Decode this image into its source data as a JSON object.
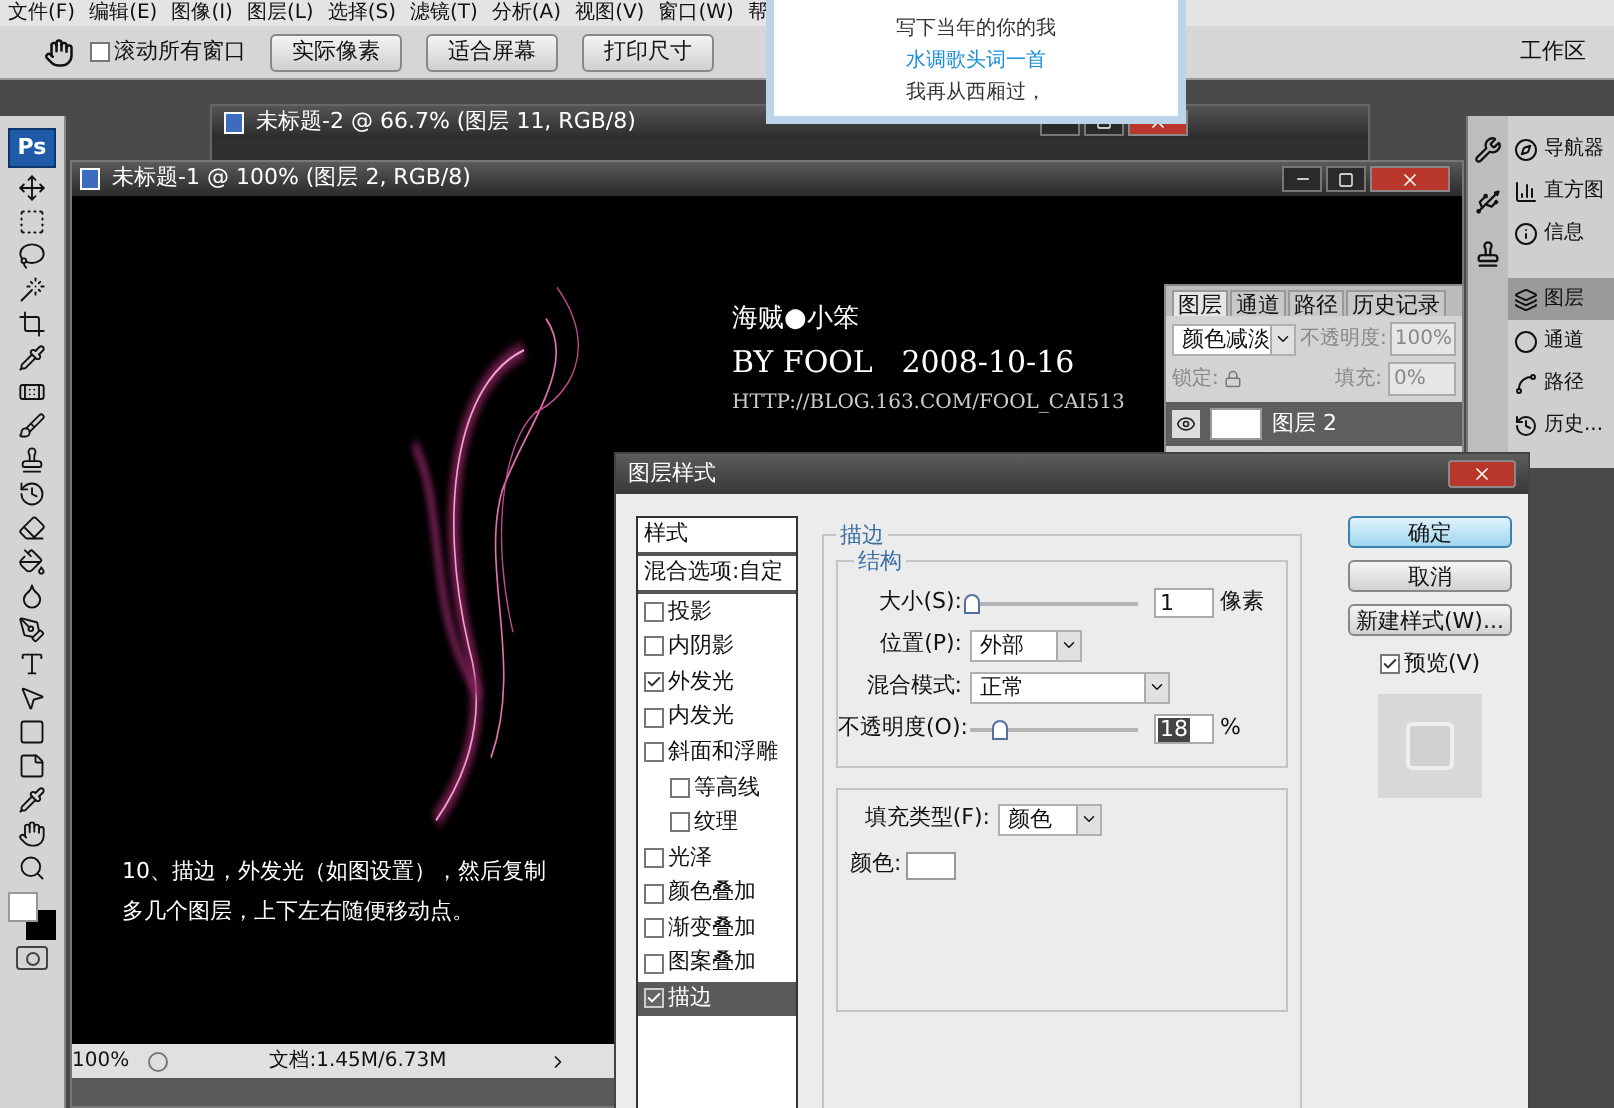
{
  "menu_bar": {
    "items": [
      "文件(F)",
      "编辑(E)",
      "图像(I)",
      "图层(L)",
      "选择(S)",
      "滤镜(T)",
      "分析(A)",
      "视图(V)",
      "窗口(W)",
      "帮"
    ]
  },
  "options_bar": {
    "scroll_all": {
      "label": "滚动所有窗口",
      "checked": false
    },
    "buttons": [
      "实际像素",
      "适合屏幕",
      "打印尺寸"
    ],
    "workspace": "工作区"
  },
  "note_popup": {
    "lines": [
      {
        "text": "写下当年的你的我",
        "kind": "plain"
      },
      {
        "text": "水调歌头词一首",
        "kind": "link"
      },
      {
        "text": "我再从西厢过，",
        "kind": "plain"
      }
    ]
  },
  "toolbox": {
    "logo": "Ps"
  },
  "back_document": {
    "title": "未标题-2 @ 66.7% (图层 11, RGB/8)"
  },
  "document": {
    "title": "未标题-1 @ 100% (图层 2, RGB/8)",
    "signature": "海贼●小笨",
    "byline": "BY FOOL   2008-10-16",
    "url": "HTTP://BLOG.163.COM/FOOL_CAI513",
    "caption_lines": [
      "10、描边，外发光（如图设置），然后复制",
      "多几个图层，上下左右随便移动点。"
    ],
    "zoom": "100%",
    "doc_size": "文档:1.45M/6.73M"
  },
  "layers_panel": {
    "tabs": [
      {
        "label": "图层",
        "selected": true
      },
      {
        "label": "通道",
        "selected": false
      },
      {
        "label": "路径",
        "selected": false
      },
      {
        "label": "历史记录",
        "selected": false
      }
    ],
    "blend_mode": "颜色减淡",
    "opacity_label": "不透明度:",
    "opacity": "100%",
    "lock_label": "锁定:",
    "fill_label": "填充:",
    "fill": "0%",
    "layers": [
      {
        "name": "图层 2",
        "visible": true,
        "selected": true
      }
    ]
  },
  "panel_dock": {
    "items": [
      {
        "label": "导航器",
        "kind": "navigator",
        "selected": false
      },
      {
        "label": "直方图",
        "kind": "histogram",
        "selected": false
      },
      {
        "label": "信息",
        "kind": "info",
        "selected": false
      },
      {
        "label": "图层",
        "kind": "layers",
        "selected": true
      },
      {
        "label": "通道",
        "kind": "channels",
        "selected": false
      },
      {
        "label": "路径",
        "kind": "paths",
        "selected": false
      },
      {
        "label": "历史...",
        "kind": "history",
        "selected": false
      }
    ]
  },
  "dialog": {
    "title": "图层样式",
    "styles": [
      {
        "label": "样式",
        "kind": "header",
        "selected": false
      },
      {
        "label": "混合选项:自定",
        "kind": "header",
        "selected": false
      },
      {
        "label": "投影",
        "kind": "check",
        "checked": false,
        "selected": false
      },
      {
        "label": "内阴影",
        "kind": "check",
        "checked": false,
        "selected": false
      },
      {
        "label": "外发光",
        "kind": "check",
        "checked": true,
        "selected": false
      },
      {
        "label": "内发光",
        "kind": "check",
        "checked": false,
        "selected": false
      },
      {
        "label": "斜面和浮雕",
        "kind": "check",
        "checked": false,
        "selected": false,
        "children": [
          {
            "label": "等高线",
            "checked": false,
            "selected": false
          },
          {
            "label": "纹理",
            "checked": false,
            "selected": false
          }
        ]
      },
      {
        "label": "光泽",
        "kind": "check",
        "checked": false,
        "selected": false
      },
      {
        "label": "颜色叠加",
        "kind": "check",
        "checked": false,
        "selected": false
      },
      {
        "label": "渐变叠加",
        "kind": "check",
        "checked": false,
        "selected": false
      },
      {
        "label": "图案叠加",
        "kind": "check",
        "checked": false,
        "selected": false
      },
      {
        "label": "描边",
        "kind": "check",
        "checked": true,
        "selected": true
      }
    ],
    "group_title": "描边",
    "structure_title": "结构",
    "size": {
      "label": "大小(S):",
      "level": 0.01,
      "value": "1",
      "unit": "像素"
    },
    "position": {
      "label": "位置(P):",
      "value": "外部"
    },
    "blend": {
      "label": "混合模式:",
      "value": "正常"
    },
    "opacity": {
      "label": "不透明度(O):",
      "level": 0.18,
      "value": "18",
      "unit": "%"
    },
    "fill_type": {
      "label": "填充类型(F):",
      "value": "颜色"
    },
    "color": {
      "label": "颜色:"
    },
    "buttons": [
      {
        "label": "确定",
        "default": true
      },
      {
        "label": "取消",
        "default": false
      },
      {
        "label": "新建样式(W)...",
        "default": false
      }
    ],
    "preview": {
      "label": "预览(V)",
      "checked": true
    }
  }
}
